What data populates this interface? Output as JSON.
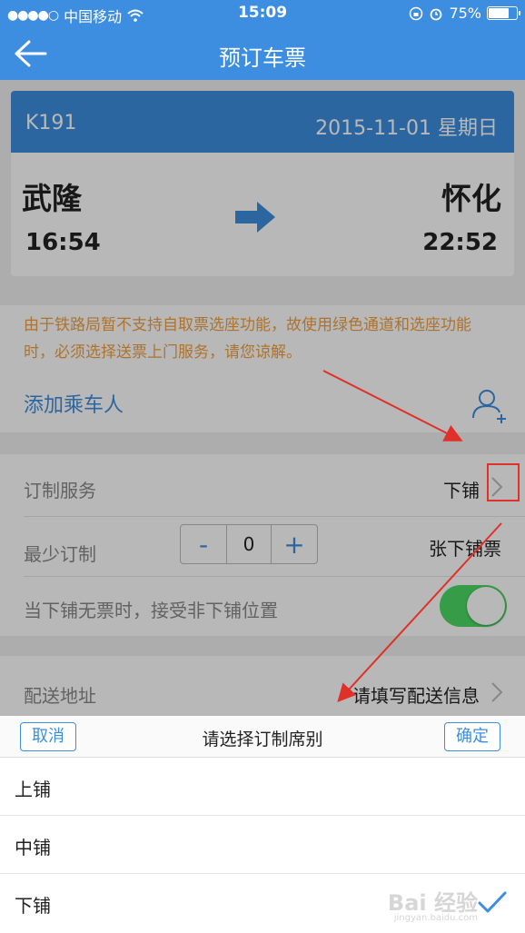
{
  "status": {
    "carrier": "中国移动",
    "time": "15:09",
    "battery": "75%",
    "battery_level": 0.75
  },
  "nav": {
    "title": "预订车票"
  },
  "ticket": {
    "train_no": "K191",
    "date": "2015-11-01 星期日",
    "from": "武隆",
    "to": "怀化",
    "depart_time": "16:54",
    "arrive_time": "22:52"
  },
  "notice": {
    "text": "由于铁路局暂不支持自取票选座功能，故使用绿色通道和选座功能时，必须选择送票上门服务，请您谅解。"
  },
  "passenger": {
    "add_label": "添加乘车人"
  },
  "service": {
    "label": "订制服务",
    "value": "下铺",
    "min_label": "最少订制",
    "minus": "-",
    "count": "0",
    "plus": "+",
    "unit_label": "张下铺票",
    "accept_label": "当下铺无票时，接受非下铺位置",
    "accept_on": true
  },
  "delivery": {
    "label": "配送地址",
    "value": "请填写配送信息"
  },
  "picker": {
    "cancel": "取消",
    "title": "请选择订制席别",
    "confirm": "确定",
    "options": [
      "上铺",
      "中铺",
      "下铺"
    ],
    "selected": "下铺"
  },
  "watermark": {
    "brand": "Bai 经验",
    "url": "jingyan.baidu.com"
  }
}
